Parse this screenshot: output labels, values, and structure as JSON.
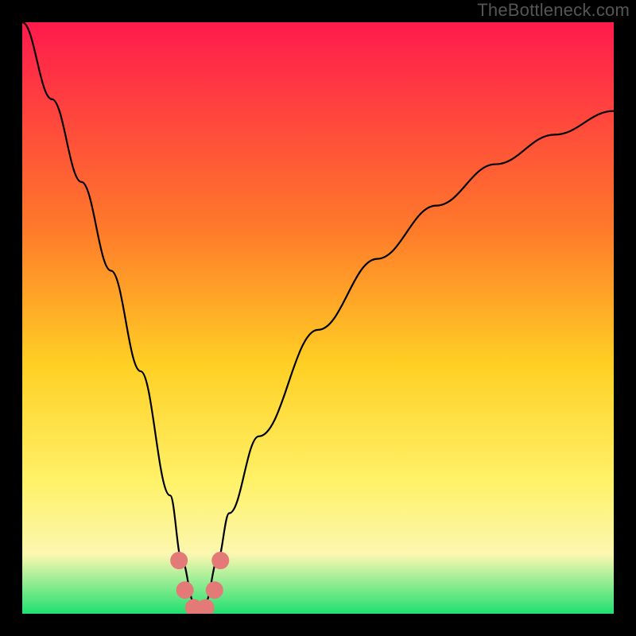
{
  "watermark": "TheBottleneck.com",
  "colors": {
    "frame": "#000000",
    "gradient_top": "#ff1a4d",
    "gradient_mid_upper": "#ff7a2a",
    "gradient_mid": "#ffd024",
    "gradient_mid_lower": "#fff26a",
    "gradient_cream": "#fbf7b0",
    "gradient_green": "#20e070",
    "curve": "#000000",
    "dots": "#e47a77"
  },
  "chart_data": {
    "type": "line",
    "title": "",
    "xlabel": "",
    "ylabel": "",
    "xlim": [
      0,
      100
    ],
    "ylim": [
      0,
      100
    ],
    "grid": false,
    "legend": false,
    "notch_x": 30,
    "series": [
      {
        "name": "bottleneck-curve",
        "x": [
          0,
          5,
          10,
          15,
          20,
          25,
          27,
          29,
          30,
          31,
          33,
          35,
          40,
          50,
          60,
          70,
          80,
          90,
          100
        ],
        "y": [
          100,
          87,
          73,
          58,
          41,
          20,
          9,
          2,
          0,
          2,
          9,
          17,
          30,
          48,
          60,
          69,
          76,
          81,
          85
        ]
      }
    ],
    "markers": [
      {
        "x": 26.5,
        "y": 9
      },
      {
        "x": 27.5,
        "y": 4
      },
      {
        "x": 29.0,
        "y": 1
      },
      {
        "x": 30.0,
        "y": 0.5
      },
      {
        "x": 31.0,
        "y": 1
      },
      {
        "x": 32.5,
        "y": 4
      },
      {
        "x": 33.5,
        "y": 9
      }
    ]
  }
}
